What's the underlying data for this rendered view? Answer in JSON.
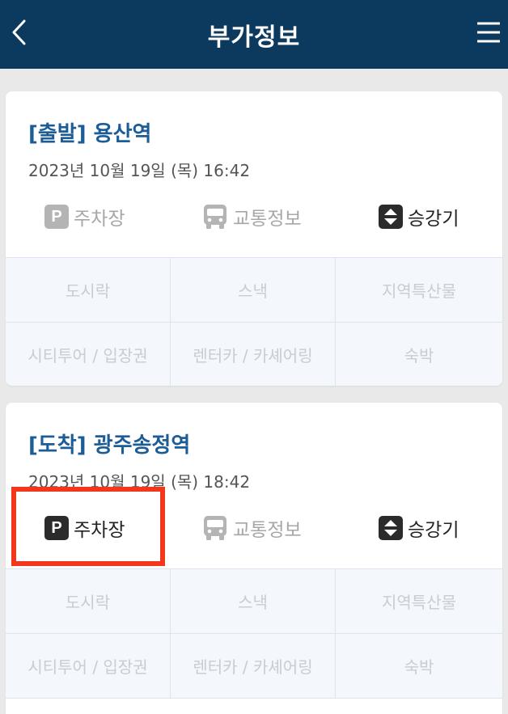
{
  "header": {
    "title": "부가정보",
    "back_icon": "chevron-left-icon",
    "menu_icon": "hamburger-menu-icon",
    "background_color": "#0b3a5e"
  },
  "cards": [
    {
      "station": "[출발] 용산역",
      "datetime": "2023년 10월 19일 (목) 16:42",
      "info": {
        "parking": {
          "label": "주차장",
          "icon": "parking-icon",
          "state": "disabled"
        },
        "traffic": {
          "label": "교통정보",
          "icon": "bus-icon",
          "state": "disabled"
        },
        "elevator": {
          "label": "승강기",
          "icon": "elevator-icon",
          "state": "enabled"
        }
      },
      "services": [
        "도시락",
        "스낵",
        "지역특산물",
        "시티투어 / 입장권",
        "렌터카 / 카셰어링",
        "숙박"
      ]
    },
    {
      "station": "[도착] 광주송정역",
      "datetime": "2023년 10월 19일 (목) 18:42",
      "info": {
        "parking": {
          "label": "주차장",
          "icon": "parking-icon",
          "state": "enabled"
        },
        "traffic": {
          "label": "교통정보",
          "icon": "bus-icon",
          "state": "disabled"
        },
        "elevator": {
          "label": "승강기",
          "icon": "elevator-icon",
          "state": "enabled"
        }
      },
      "services": [
        "도시락",
        "스낵",
        "지역특산물",
        "시티투어 / 입장권",
        "렌터카 / 카셰어링",
        "숙박"
      ]
    }
  ],
  "colors": {
    "station_title": "#1c5d97",
    "highlight_border": "#f2371c",
    "disabled_text": "#a7a7a7"
  }
}
